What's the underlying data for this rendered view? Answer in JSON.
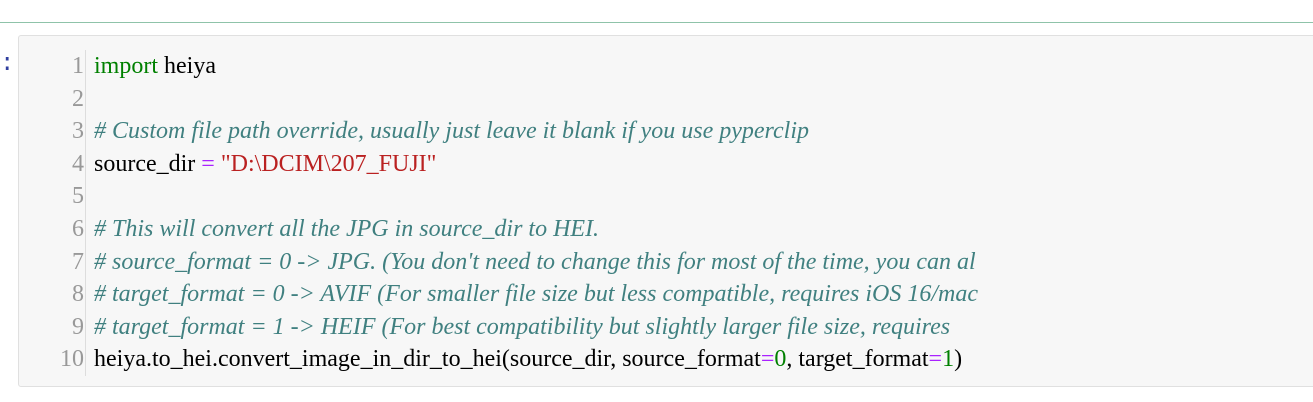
{
  "prompt": {
    "marker": ":"
  },
  "cell": {
    "line_numbers": [
      "1",
      "2",
      "3",
      "4",
      "5",
      "6",
      "7",
      "8",
      "9",
      "10"
    ],
    "lines": {
      "l1": {
        "kw": "import",
        "rest": " heiya"
      },
      "l3": {
        "comment": "# Custom file path override, usually just leave it blank if you use pyperclip"
      },
      "l4": {
        "name": "source_dir ",
        "op": "=",
        "sp": " ",
        "str": "\"D:\\DCIM\\207_FUJI\""
      },
      "l6": {
        "comment": "# This will convert all the JPG in source_dir to HEI."
      },
      "l7": {
        "comment": "# source_format = 0 -> JPG. (You don't need to change this for most of the time, you can al"
      },
      "l8": {
        "comment": "# target_format = 0 -> AVIF (For smaller file size but less compatible, requires iOS 16/mac"
      },
      "l9": {
        "comment": "# target_format = 1 -> HEIF (For best compatibility but slightly larger file size, requires"
      },
      "l10": {
        "a": "heiya.to_hei.convert_image_in_dir_to_hei(source_dir, source_format",
        "op1": "=",
        "n1": "0",
        "b": ", target_format",
        "op2": "=",
        "n2": "1",
        "c": ")"
      }
    }
  },
  "colors": {
    "keyword": "#008000",
    "comment": "#408080",
    "string": "#ba2121",
    "operator": "#aa22ff",
    "line_number": "#999999",
    "cell_bg": "#f7f7f7"
  }
}
